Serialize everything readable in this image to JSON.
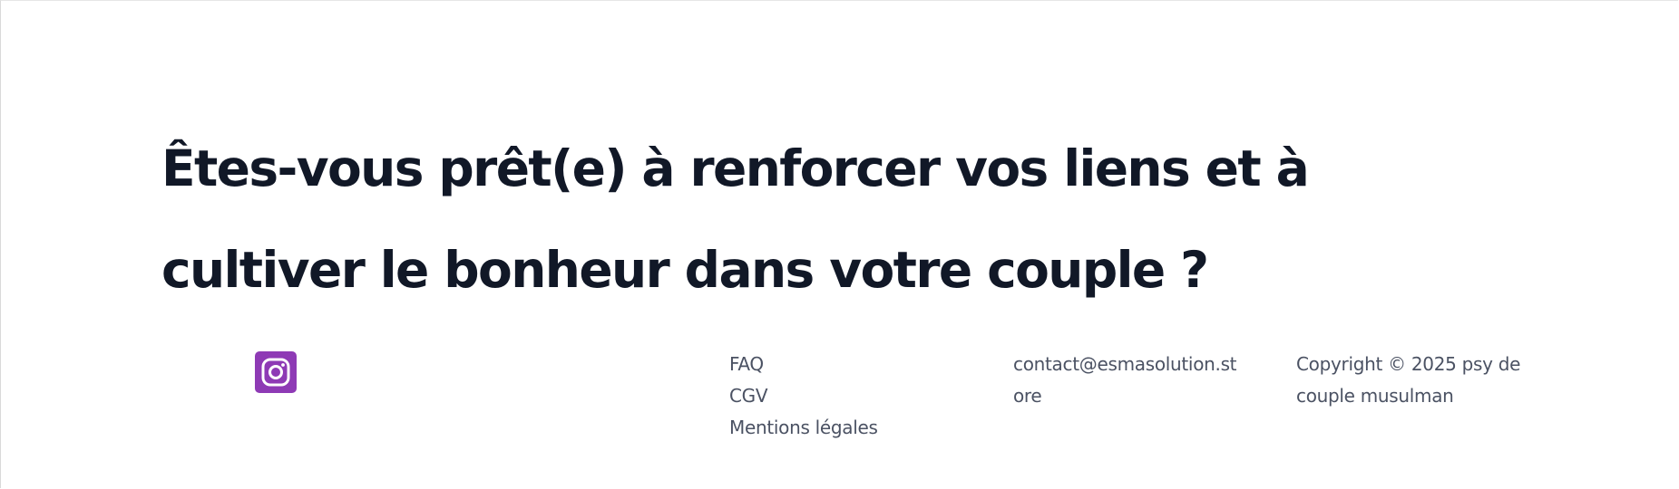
{
  "cta": {
    "headline": "Êtes-vous prêt(e) à renforcer vos liens et à cultiver le bonheur dans votre couple ?"
  },
  "footer": {
    "social": {
      "icon": "instagram-icon",
      "color": "#8e3ab5"
    },
    "links": [
      {
        "label": "FAQ"
      },
      {
        "label": "CGV"
      },
      {
        "label": "Mentions légales"
      }
    ],
    "contact_email": "contact@esmasolution.store",
    "copyright": "Copyright © 2025 psy de couple musulman"
  },
  "colors": {
    "heading": "#111827",
    "body_text": "#4b5263",
    "background": "#ffffff"
  }
}
